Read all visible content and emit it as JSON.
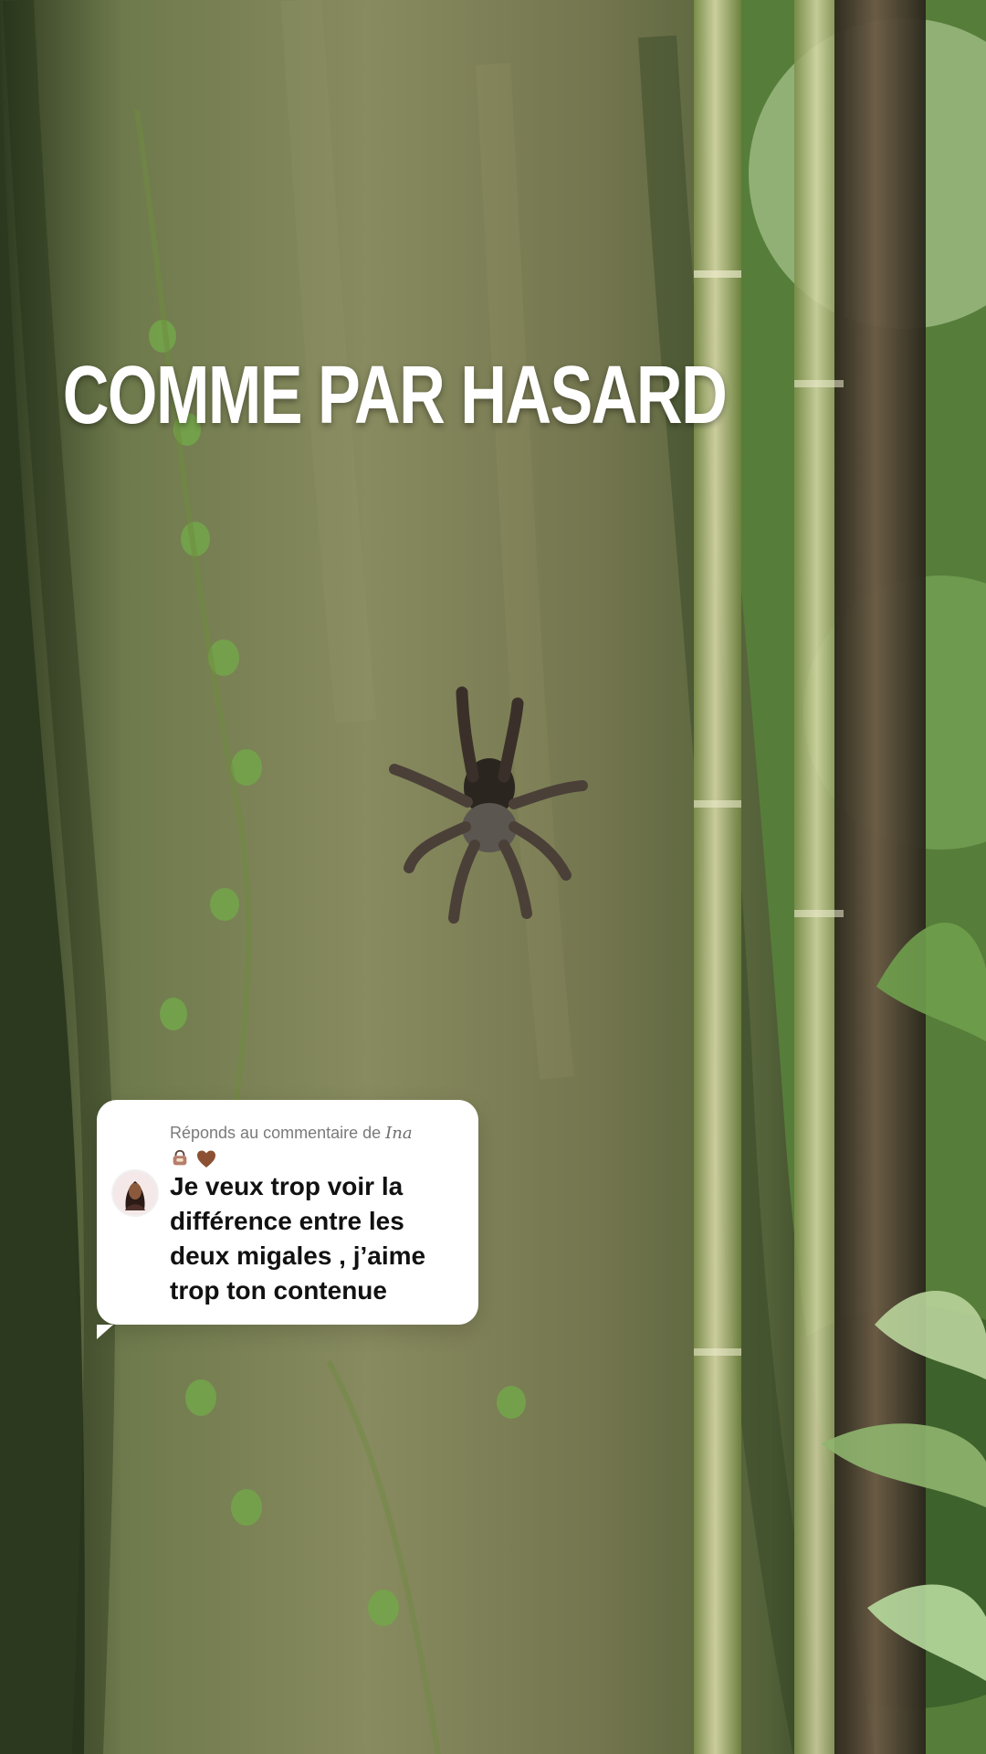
{
  "overlay": {
    "title": "COMME PAR HASARD"
  },
  "reply_card": {
    "header_prefix": "Réponds au commentaire de ",
    "username": "Ina",
    "comment": "Je veux trop voir la\ndifférence entre les\ndeux migales , j’aime\ntrop ton contenue",
    "emoji_icons": [
      "bag-icon",
      "brown-heart-icon"
    ]
  },
  "colors": {
    "card_background": "#ffffff",
    "title_text": "#ffffff",
    "comment_text": "#111111",
    "secondary_text": "#7a7a7a"
  }
}
